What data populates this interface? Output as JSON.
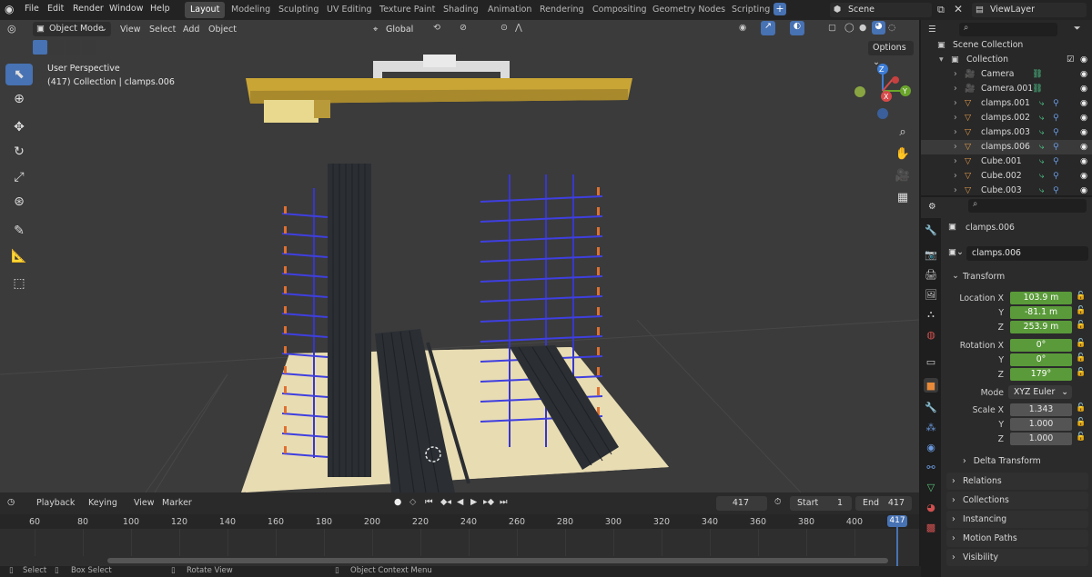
{
  "menus": [
    "File",
    "Edit",
    "Render",
    "Window",
    "Help"
  ],
  "workspaces": [
    "Layout",
    "Modeling",
    "Sculpting",
    "UV Editing",
    "Texture Paint",
    "Shading",
    "Animation",
    "Rendering",
    "Compositing",
    "Geometry Nodes",
    "Scripting"
  ],
  "active_workspace": "Layout",
  "scene_name": "Scene",
  "view_layer": "ViewLayer",
  "viewport": {
    "mode": "Object Mode",
    "menus": [
      "View",
      "Select",
      "Add",
      "Object"
    ],
    "transform_orientation": "Global",
    "options_label": "Options",
    "overlay_line1": "User Perspective",
    "overlay_line2": "(417) Collection | clamps.006",
    "axes": {
      "x": "X",
      "y": "Y",
      "z": "Z"
    }
  },
  "timeline": {
    "menus": [
      "Playback",
      "Keying",
      "View",
      "Marker"
    ],
    "current_frame": "417",
    "start_label": "Start",
    "start": "1",
    "end_label": "End",
    "end": "417",
    "ticks": [
      "60",
      "80",
      "100",
      "120",
      "140",
      "160",
      "180",
      "200",
      "220",
      "240",
      "260",
      "280",
      "300",
      "320",
      "340",
      "360",
      "380",
      "400"
    ],
    "playhead": "417"
  },
  "statusbar": [
    "Select",
    "Box Select",
    "Rotate View",
    "Object Context Menu"
  ],
  "outliner": {
    "root": "Scene Collection",
    "collection": "Collection",
    "items": [
      {
        "name": "Camera",
        "type": "camera"
      },
      {
        "name": "Camera.001",
        "type": "camera"
      },
      {
        "name": "clamps.001",
        "type": "mesh"
      },
      {
        "name": "clamps.002",
        "type": "mesh"
      },
      {
        "name": "clamps.003",
        "type": "mesh"
      },
      {
        "name": "clamps.006",
        "type": "mesh"
      },
      {
        "name": "Cube.001",
        "type": "mesh"
      },
      {
        "name": "Cube.002",
        "type": "mesh"
      },
      {
        "name": "Cube.003",
        "type": "mesh"
      }
    ]
  },
  "properties": {
    "object_name": "clamps.006",
    "data_name": "clamps.006",
    "transform_title": "Transform",
    "location_label": "Location X",
    "location": [
      "103.9 m",
      "-81.1 m",
      "253.9 m"
    ],
    "rotation_label": "Rotation X",
    "rotation": [
      "0°",
      "0°",
      "179°"
    ],
    "mode_label": "Mode",
    "mode": "XYZ Euler",
    "scale_label": "Scale X",
    "scale": [
      "1.343",
      "1.000",
      "1.000"
    ],
    "y_label": "Y",
    "z_label": "Z",
    "sections": [
      "Delta Transform",
      "Relations",
      "Collections",
      "Instancing",
      "Motion Paths",
      "Visibility"
    ]
  }
}
